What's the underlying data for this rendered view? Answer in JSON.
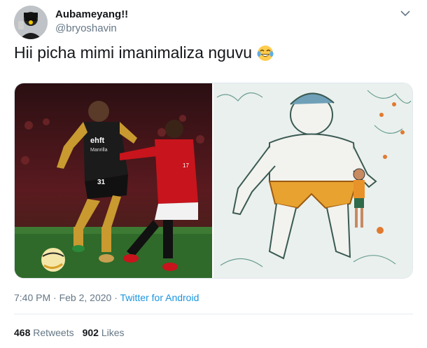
{
  "tweet": {
    "display_name": "Aubameyang!!",
    "handle": "@bryoshavin",
    "text": "Hii picha mimi imanimaliza nguvu",
    "emoji": "face-with-tears-of-joy-icon",
    "time": "7:40 PM",
    "separator": "·",
    "date": "Feb 2, 2020",
    "source": "Twitter for Android"
  },
  "stats": {
    "retweets_count": "468",
    "retweets_label": "Retweets",
    "likes_count": "902",
    "likes_label": "Likes"
  },
  "media": {
    "left_image": "football-photo",
    "right_image": "cartoon-illustration",
    "shirt_text": "ehft",
    "shirt_sub": "Manrilla",
    "number_left": "31",
    "number_right": "17"
  },
  "colors": {
    "link": "#1b95e0",
    "secondary_text": "#657786",
    "divider": "#e6ecf0"
  }
}
